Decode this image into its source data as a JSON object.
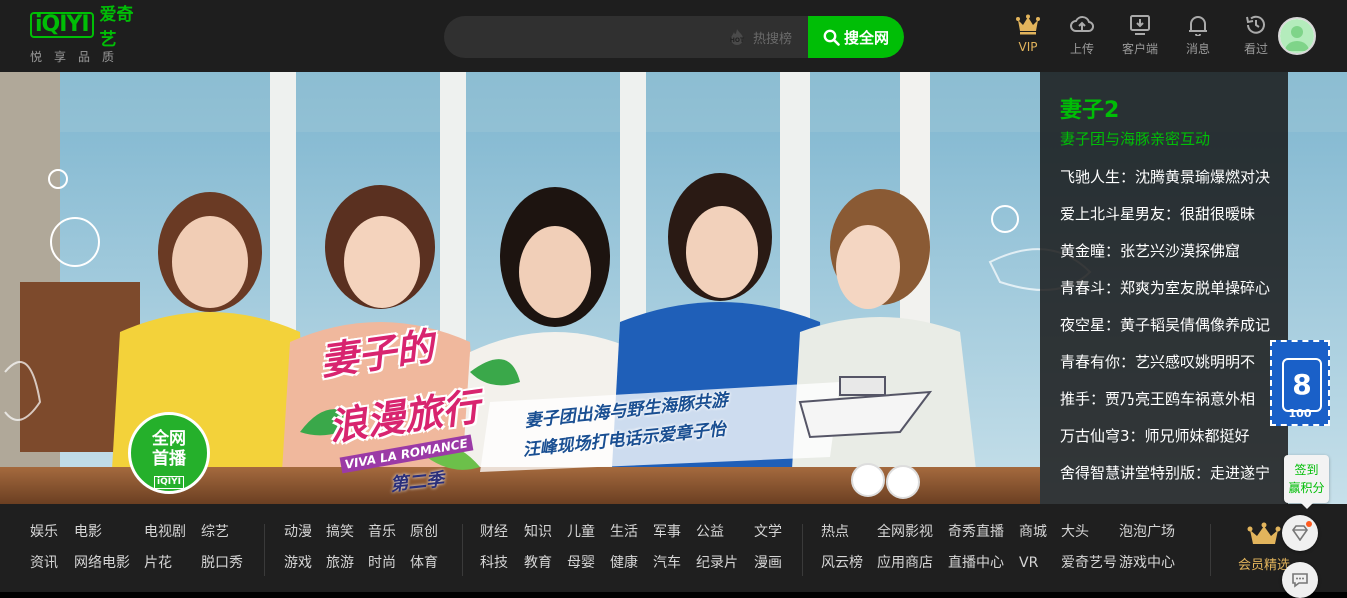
{
  "header": {
    "logo_text": "iQIYI",
    "logo_cn": "爱奇艺",
    "slogan": "悦享品质",
    "search": {
      "placeholder": "",
      "hot_label": "热搜榜",
      "hot_icon": "hot-icon",
      "button_label": "搜全网"
    },
    "nav": [
      {
        "label": "VIP",
        "icon": "crown-icon"
      },
      {
        "label": "上传",
        "icon": "upload-cloud-icon"
      },
      {
        "label": "客户端",
        "icon": "monitor-download-icon"
      },
      {
        "label": "消息",
        "icon": "bell-icon"
      },
      {
        "label": "看过",
        "icon": "history-icon"
      }
    ],
    "avatar_icon": "user-avatar-icon"
  },
  "banner": {
    "show_title_line1": "妻子的",
    "show_title_line2": "浪漫旅行",
    "show_title_en": "VIVA LA ROMANCE",
    "show_season": "第二季",
    "caption_line1": "妻子团出海与野生海豚共游",
    "caption_line2": "汪峰现场打电话示爱章子怡",
    "premiere_badge_line1": "全网",
    "premiere_badge_line2": "首播",
    "premiere_badge_logo": "iQIYI",
    "stamp_number": "8",
    "stamp_text": "100"
  },
  "side_list": {
    "title": "妻子2",
    "subtitle": "妻子团与海豚亲密互动",
    "items": [
      "飞驰人生：沈腾黄景瑜爆燃对决",
      "爱上北斗星男友：很甜很暧昧",
      "黄金瞳：张艺兴沙漠探佛窟",
      "青春斗：郑爽为室友脱单操碎心",
      "夜空星：黄子韬吴倩偶像养成记",
      "青春有你：艺兴感叹姚明明不",
      "推手：贾乃亮王鸥车祸意外相",
      "万古仙穹3：师兄师妹都挺好",
      "舍得智慧讲堂特别版：走进遂宁"
    ]
  },
  "categories": {
    "group1": [
      [
        "娱乐",
        "电影",
        "电视剧",
        "综艺"
      ],
      [
        "资讯",
        "网络电影",
        "片花",
        "脱口秀"
      ]
    ],
    "group2": [
      [
        "动漫",
        "搞笑",
        "音乐",
        "原创"
      ],
      [
        "游戏",
        "旅游",
        "时尚",
        "体育"
      ]
    ],
    "group3": [
      [
        "财经",
        "知识",
        "儿童",
        "生活",
        "军事",
        "公益",
        "文学"
      ],
      [
        "科技",
        "教育",
        "母婴",
        "健康",
        "汽车",
        "纪录片",
        "漫画"
      ]
    ],
    "group4": [
      [
        "热点",
        "全网影视",
        "奇秀直播",
        "商城",
        "大头",
        "泡泡广场"
      ],
      [
        "风云榜",
        "应用商店",
        "直播中心",
        "VR",
        "爱奇艺号",
        "游戏中心"
      ]
    ],
    "vip_label": "会员精选"
  },
  "floating": {
    "signin_line1": "签到",
    "signin_line2": "赢积分",
    "gift_icon": "diamond-icon",
    "feedback_icon": "chat-bubble-icon"
  },
  "colors": {
    "brand_green": "#00be06",
    "vip_gold": "#e2b45c",
    "background": "#1f1f1f"
  }
}
